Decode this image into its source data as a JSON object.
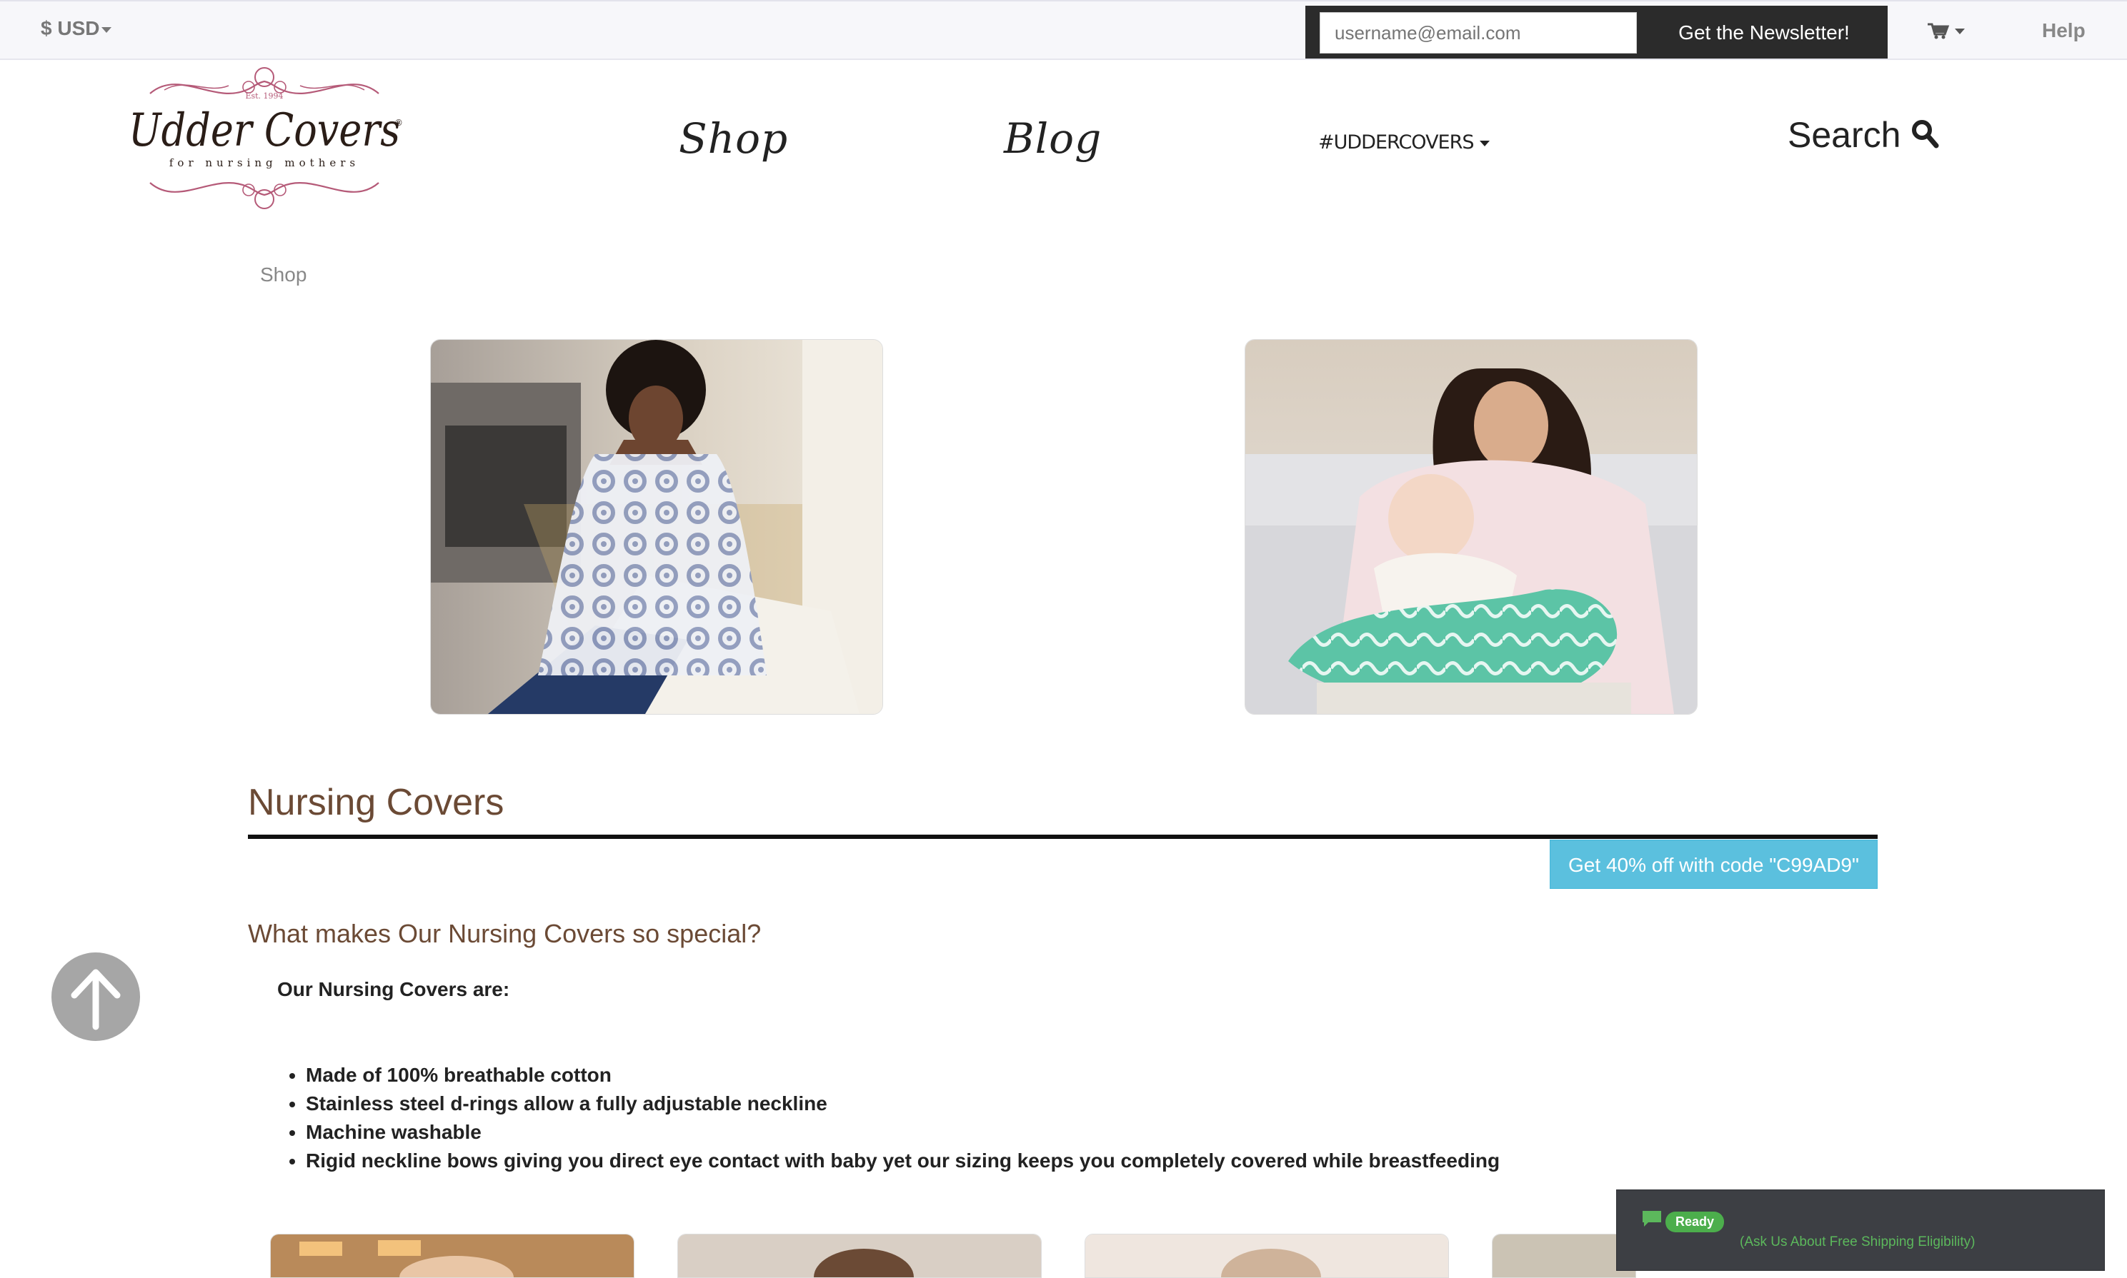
{
  "topbar": {
    "currency": "$ USD",
    "newsletter_placeholder": "username@email.com",
    "newsletter_button": "Get the Newsletter!",
    "help": "Help"
  },
  "logo": {
    "est": "Est. 1994",
    "name": "Udder Covers",
    "tagline": "for nursing mothers",
    "registered": "®"
  },
  "nav": {
    "shop": "Shop",
    "blog": "Blog",
    "hashtag": "#UDDERCOVERS",
    "search": "Search"
  },
  "breadcrumb": {
    "current": "Shop"
  },
  "section": {
    "title": "Nursing Covers",
    "promo": "Get 40% off with code \"C99AD9\"",
    "subheading": "What makes Our Nursing Covers so special?",
    "intro": "Our Nursing Covers are:",
    "features": [
      "Made of 100% breathable cotton",
      "Stainless steel d-rings allow a fully adjustable neckline",
      "Machine washable",
      "Rigid neckline bows giving you direct eye contact with baby yet our sizing keeps you completely covered while breastfeeding"
    ]
  },
  "chat": {
    "status": "Ready",
    "message": "(Ask Us About Free Shipping Eligibility)"
  },
  "colors": {
    "brand_brown": "#6b4a35",
    "promo_blue": "#5bc0de",
    "logo_pink": "#b55a78",
    "chat_green": "#4cae4c"
  },
  "icons": [
    "caret-down-icon",
    "cart-icon",
    "search-icon",
    "arrow-up-icon",
    "chat-bubble-icon"
  ]
}
